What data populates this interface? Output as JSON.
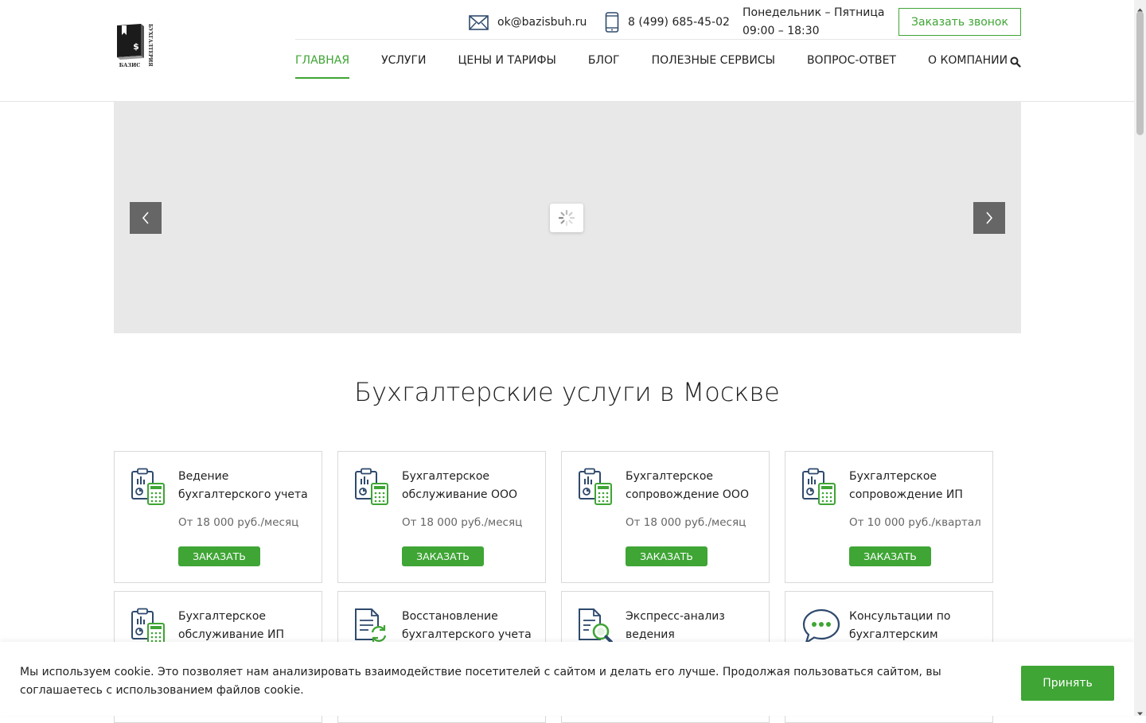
{
  "header": {
    "email": "ok@bazisbuh.ru",
    "phone": "8 (499) 685-45-02",
    "hours_days": "Понедельник – Пятница",
    "hours_time": "09:00 – 18:30",
    "call_button": "Заказать звонок",
    "logo_text_vertical": "БУХГАЛТЕРИЯ",
    "logo_text_bottom": "БАЗИС"
  },
  "nav": [
    {
      "label": "ГЛАВНАЯ",
      "active": true
    },
    {
      "label": "УСЛУГИ"
    },
    {
      "label": "ЦЕНЫ И ТАРИФЫ"
    },
    {
      "label": "БЛОГ"
    },
    {
      "label": "ПОЛЕЗНЫЕ СЕРВИСЫ"
    },
    {
      "label": "ВОПРОС-ОТВЕТ"
    },
    {
      "label": "О КОМПАНИИ"
    }
  ],
  "section_title": "Бухгалтерские услуги в Москве",
  "services": [
    {
      "title": "Ведение бухгалтерского учета",
      "price": "От 18 000 руб./месяц",
      "button": "ЗАКАЗАТЬ",
      "icon": "clipboard-calculator-icon"
    },
    {
      "title": "Бухгалтерское обслуживание ООО",
      "price": "От 18 000 руб./месяц",
      "button": "ЗАКАЗАТЬ",
      "icon": "clipboard-calculator-icon"
    },
    {
      "title": "Бухгалтерское сопровождение ООО",
      "price": "От 18 000 руб./месяц",
      "button": "ЗАКАЗАТЬ",
      "icon": "clipboard-calculator-icon"
    },
    {
      "title": "Бухгалтерское сопровождение ИП",
      "price": "От 10 000 руб./квартал",
      "button": "ЗАКАЗАТЬ",
      "icon": "clipboard-calculator-icon"
    },
    {
      "title": "Бухгалтерское обслуживание ИП",
      "icon": "clipboard-calculator-icon"
    },
    {
      "title": "Восстановление бухгалтерского учета",
      "icon": "document-refresh-icon"
    },
    {
      "title": "Экспресс-анализ ведения",
      "icon": "document-magnifier-icon"
    },
    {
      "title": "Консультации по бухгалтерским",
      "icon": "chat-bubble-icon"
    }
  ],
  "cookie": {
    "text": "Мы используем cookie.  Это позволяет нам анализировать взаимодействие посетителей с сайтом и делать его лучше. Продолжая пользоваться сайтом, вы соглашаетесь с использованием файлов cookie.",
    "button": "Принять"
  },
  "colors": {
    "accent": "#3fa535",
    "icon_blue": "#2f4a6d",
    "slider_bg": "#e8e8e8",
    "arrow_bg": "#666666"
  }
}
